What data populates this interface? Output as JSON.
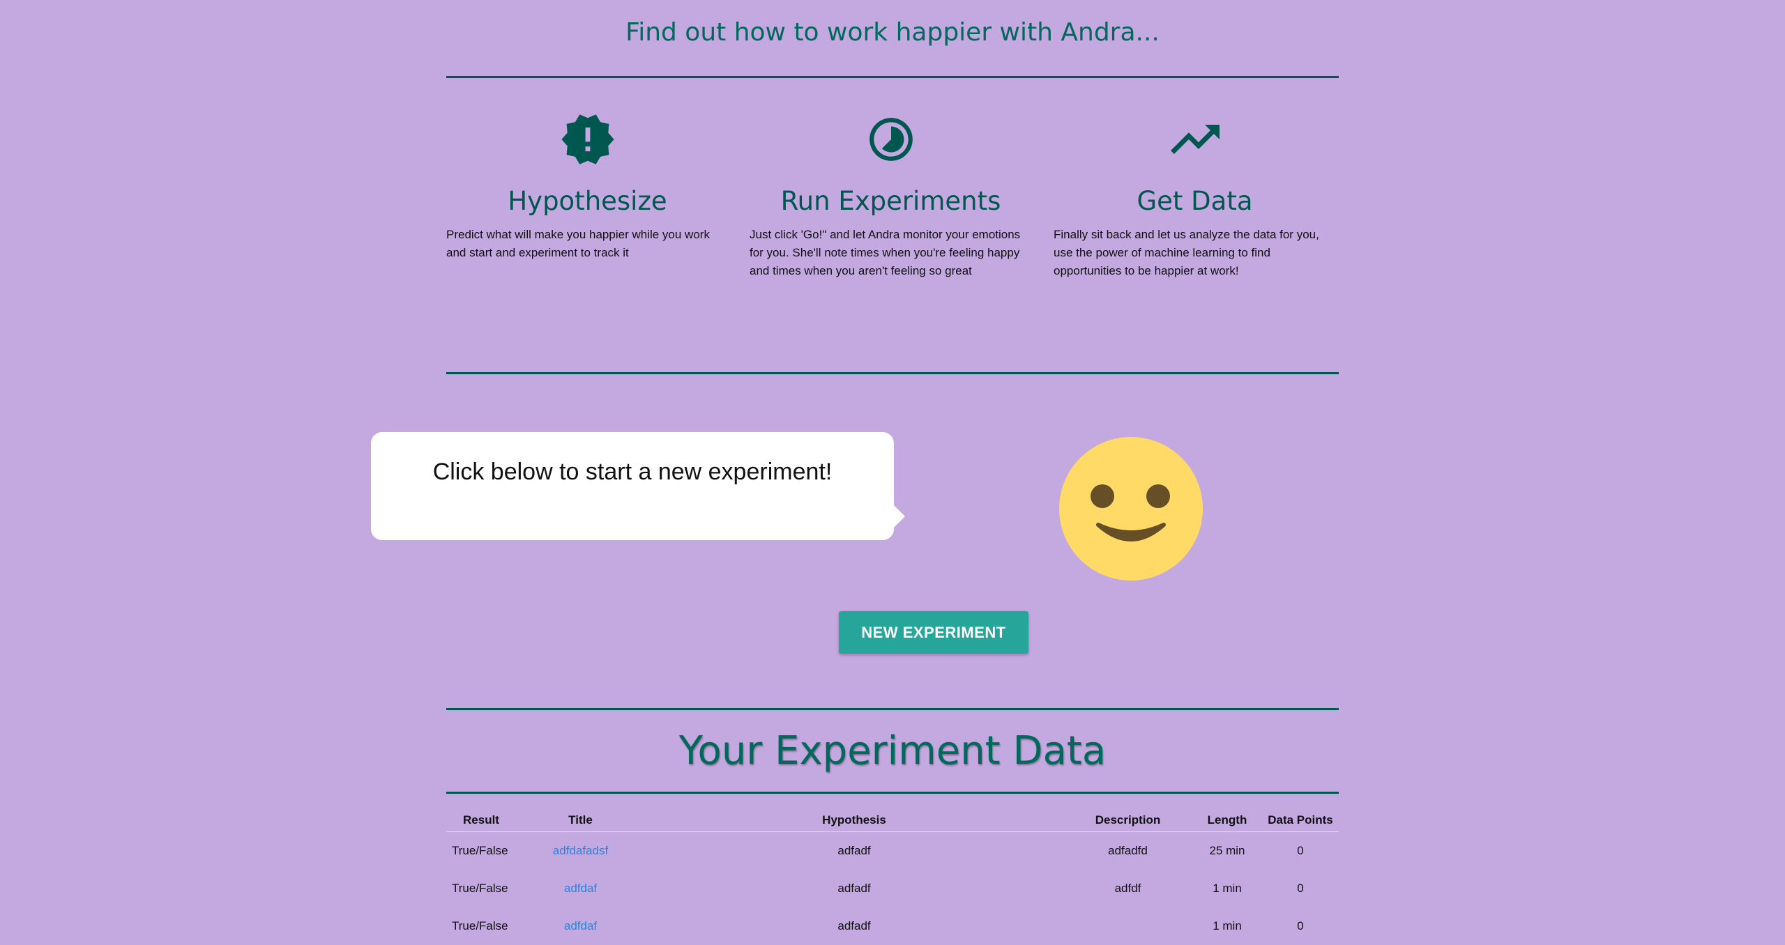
{
  "tagline": "Find out how to work happier with Andra...",
  "features": [
    {
      "icon": "new-releases-icon",
      "title": "Hypothesize",
      "text": "Predict what will make you happier while you work and start and experiment to track it"
    },
    {
      "icon": "timelapse-icon",
      "title": "Run Experiments",
      "text": "Just click 'Go!\" and let Andra monitor your emotions for you. She'll note times when you're feeling happy and times when you aren't feeling so great"
    },
    {
      "icon": "trending-up-icon",
      "title": "Get Data",
      "text": "Finally sit back and let us analyze the data for you, use the power of machine learning to find opportunities to be happier at work!"
    }
  ],
  "bubble_text": "Click below to start a new experiment!",
  "new_experiment_label": "NEW EXPERIMENT",
  "data_title": "Your Experiment Data",
  "table": {
    "headers": [
      "Result",
      "Title",
      "Hypothesis",
      "Description",
      "Length",
      "Data Points"
    ],
    "rows": [
      [
        "True/False",
        "adfdafadsf",
        "adfadf",
        "adfadfd",
        "25 min",
        "0"
      ],
      [
        "True/False",
        "adfdaf",
        "adfadf",
        "adfdf",
        "1 min",
        "0"
      ],
      [
        "True/False",
        "adfdaf",
        "adfadf",
        "",
        "1 min",
        "0"
      ]
    ]
  },
  "colors": {
    "background": "#c4a9e0",
    "accent": "#00574f",
    "button": "#26a69a",
    "link": "#1e88e5",
    "smiley": "#ffda66"
  }
}
